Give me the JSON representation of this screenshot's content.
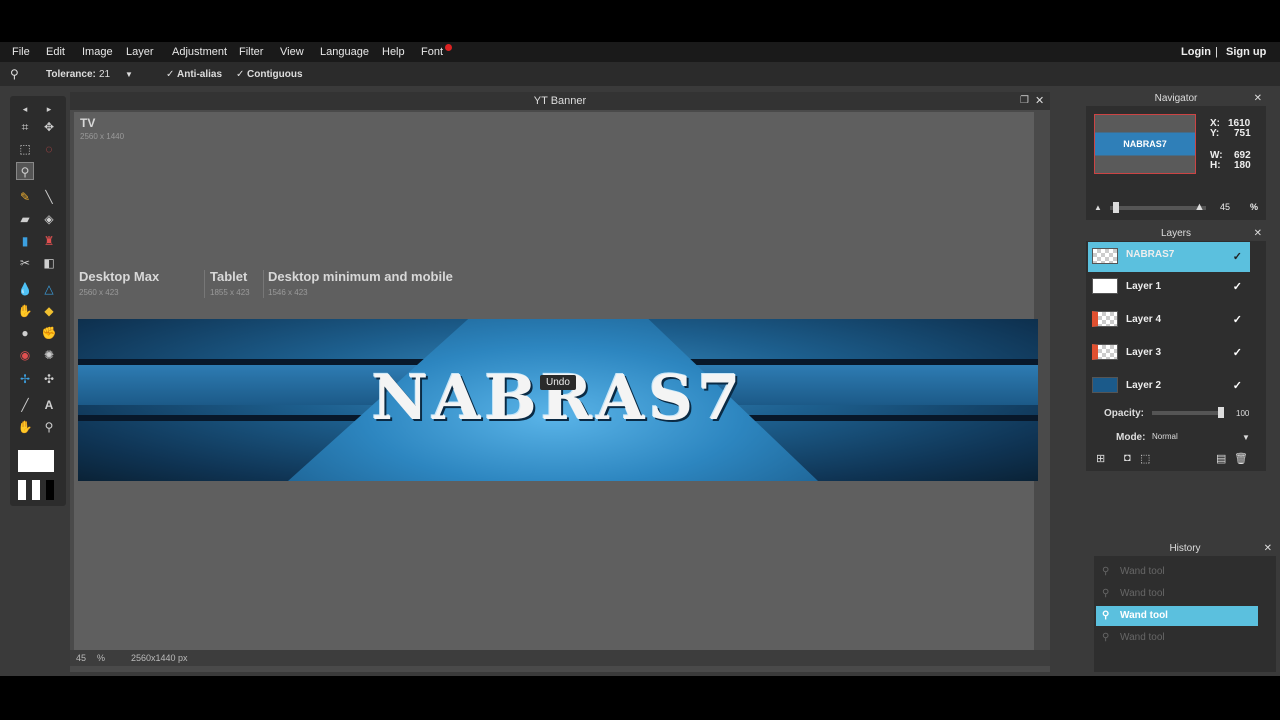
{
  "menubar": {
    "items": [
      "File",
      "Edit",
      "Image",
      "Layer",
      "Adjustment",
      "Filter",
      "View",
      "Language",
      "Help",
      "Font"
    ],
    "login": "Login",
    "separator": "|",
    "signup": "Sign up"
  },
  "options": {
    "tolerance_label": "Tolerance:",
    "tolerance_value": "21",
    "anti_alias": "Anti-alias",
    "contiguous": "Contiguous",
    "checkmark": "✓"
  },
  "document": {
    "title": "YT Banner",
    "zones": {
      "tv": {
        "label": "TV",
        "size": "2560 x 1440"
      },
      "desktop_max": {
        "label": "Desktop Max",
        "size": "2560 x 423"
      },
      "tablet": {
        "label": "Tablet",
        "size": "1855 x 423"
      },
      "mobile": {
        "label": "Desktop minimum and mobile",
        "size": "1546 x 423"
      }
    },
    "banner_text": "NABRAS7",
    "tooltip": "Undo",
    "status_zoom": "45",
    "status_percent": "%",
    "status_size": "2560x1440 px"
  },
  "navigator": {
    "title": "Navigator",
    "thumb_text": "NABRAS7",
    "x_label": "X:",
    "x_value": "1610",
    "y_label": "Y:",
    "y_value": "751",
    "w_label": "W:",
    "w_value": "692",
    "h_label": "H:",
    "h_value": "180",
    "zoom_value": "45",
    "zoom_unit": "%"
  },
  "layers": {
    "title": "Layers",
    "items": [
      {
        "name": "NABRAS7",
        "active": true
      },
      {
        "name": "Layer 1",
        "active": false
      },
      {
        "name": "Layer 4",
        "active": false
      },
      {
        "name": "Layer 3",
        "active": false
      },
      {
        "name": "Layer 2",
        "active": false
      }
    ],
    "opacity_label": "Opacity:",
    "opacity_value": "100",
    "mode_label": "Mode:",
    "mode_value": "Normal"
  },
  "history": {
    "title": "History",
    "items": [
      "Wand tool",
      "Wand tool",
      "Wand tool",
      "Wand tool"
    ],
    "active_index": 2
  },
  "colors": {
    "accent": "#5bc0de",
    "badge": "#dd2222",
    "close_glyph": "✕"
  }
}
